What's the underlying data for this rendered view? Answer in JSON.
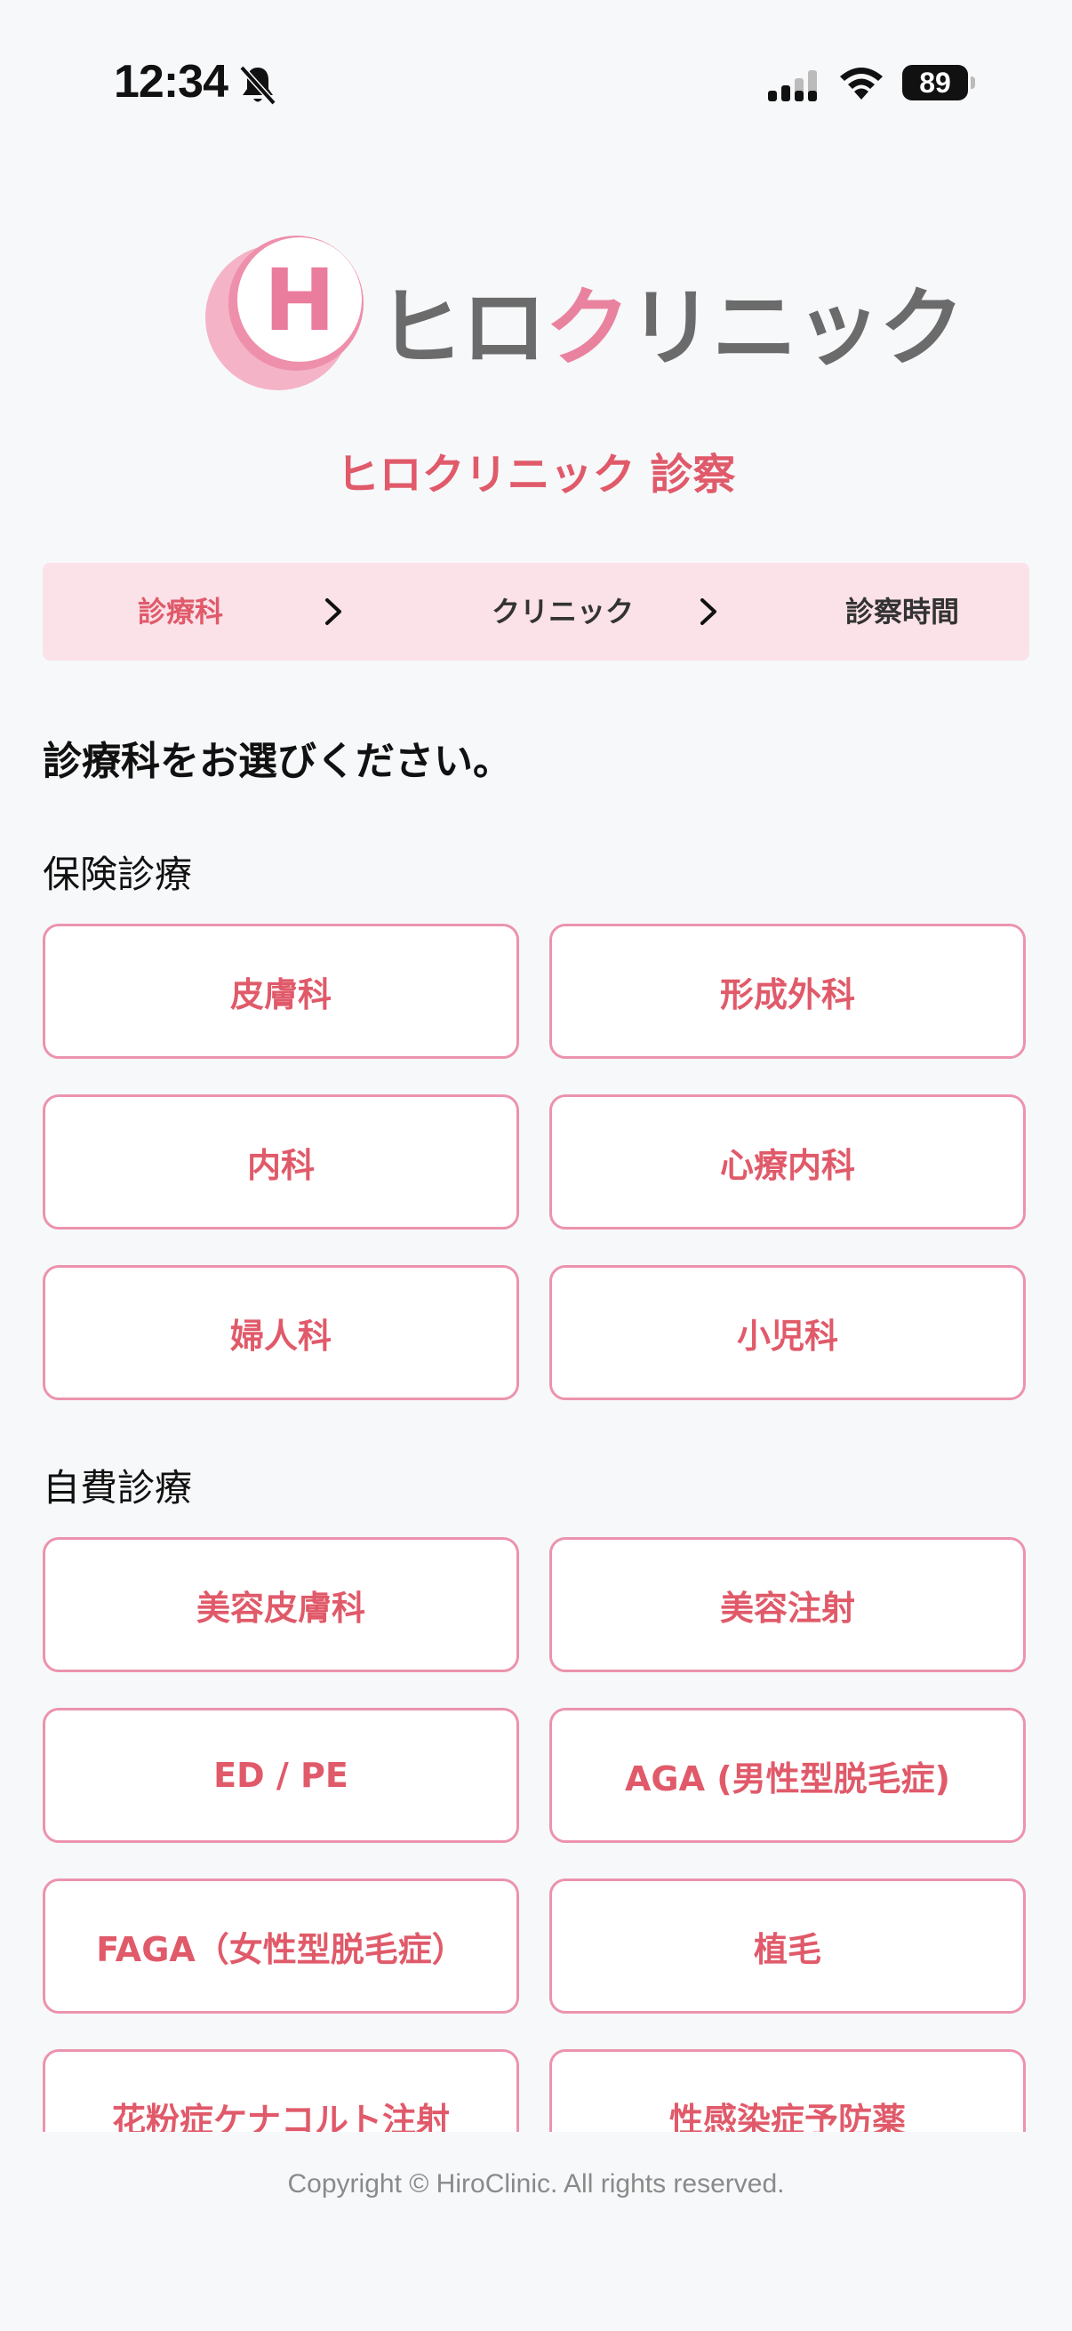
{
  "status_bar": {
    "time": "12:34",
    "battery_level": "89",
    "icons": [
      "bell-slash-icon",
      "cellular-signal-icon",
      "wifi-icon",
      "battery-icon"
    ]
  },
  "logo": {
    "mark_letter": "H",
    "name_part1": "ヒロ",
    "name_accent": "ク",
    "name_part2": "リニック"
  },
  "page_title": "ヒロクリニック 診察",
  "steps": [
    {
      "label": "診療科",
      "active": true
    },
    {
      "label": "クリニック",
      "active": false
    },
    {
      "label": "診察時間",
      "active": false
    }
  ],
  "instruction": "診療科をお選びください。",
  "sections": [
    {
      "title": "保険診療",
      "items": [
        "皮膚科",
        "形成外科",
        "内科",
        "心療内科",
        "婦人科",
        "小児科"
      ]
    },
    {
      "title": "自費診療",
      "items": [
        "美容皮膚科",
        "美容注射",
        "ED / PE",
        "AGA (男性型脱毛症)",
        "FAGA（女性型脱毛症）",
        "植毛",
        "花粉症ケナコルト注射",
        "性感染症予防薬"
      ]
    }
  ],
  "footer": {
    "copyright": "Copyright © HiroClinic. All rights reserved."
  },
  "colors": {
    "accent": "#e05a6a",
    "border_pink": "#ec93ad",
    "step_bar_bg": "#fbe2e8",
    "logo_pink": "#e9829f",
    "logo_gray": "#6b6b6b"
  }
}
